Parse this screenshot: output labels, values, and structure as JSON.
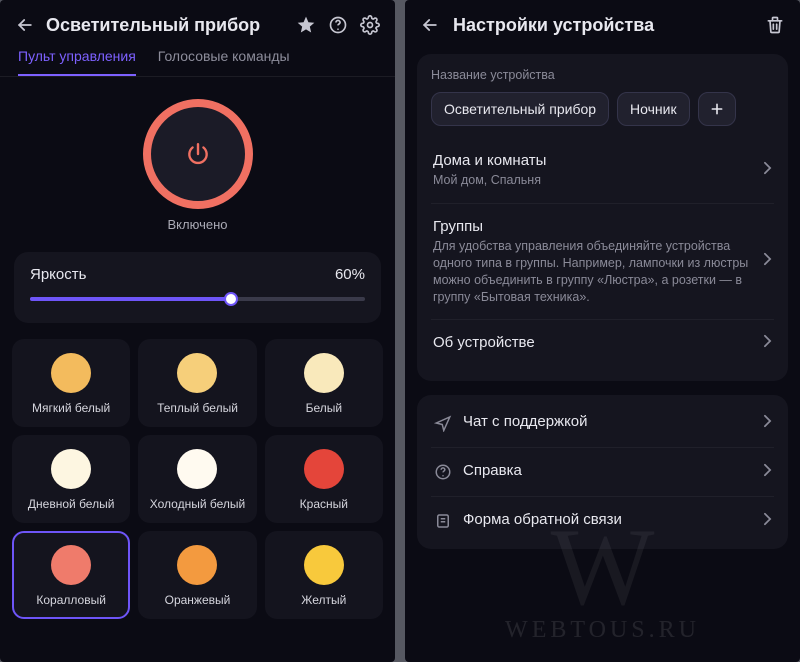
{
  "left": {
    "title": "Осветительный прибор",
    "tabs": {
      "control": "Пульт управления",
      "voice": "Голосовые команды"
    },
    "power_state": "Включено",
    "brightness": {
      "label": "Яркость",
      "value_text": "60%",
      "percent": 60
    },
    "colors": [
      {
        "name": "Мягкий белый",
        "hex": "#f3bb5d",
        "selected": false
      },
      {
        "name": "Теплый белый",
        "hex": "#f6cf7a",
        "selected": false
      },
      {
        "name": "Белый",
        "hex": "#f9e9bb",
        "selected": false
      },
      {
        "name": "Дневной белый",
        "hex": "#fdf6e1",
        "selected": false
      },
      {
        "name": "Холодный белый",
        "hex": "#fffaf0",
        "selected": false
      },
      {
        "name": "Красный",
        "hex": "#e4453a",
        "selected": false
      },
      {
        "name": "Коралловый",
        "hex": "#ef7b6b",
        "selected": true
      },
      {
        "name": "Оранжевый",
        "hex": "#f39a3f",
        "selected": false
      },
      {
        "name": "Желтый",
        "hex": "#f8c93c",
        "selected": false
      }
    ]
  },
  "right": {
    "title": "Настройки устройства",
    "device_name_section": {
      "label": "Название устройства",
      "chips": [
        "Осветительный прибор",
        "Ночник"
      ]
    },
    "rows1": [
      {
        "title": "Дома и комнаты",
        "sub": "Мой дом, Спальня"
      },
      {
        "title": "Группы",
        "sub": "Для удобства управления объединяйте устройства одного типа в группы. Например, лампочки из люстры можно объединить в группу «Люстра», а розетки — в группу «Бытовая техника»."
      },
      {
        "title": "Об устройстве",
        "sub": ""
      }
    ],
    "rows2": [
      {
        "icon": "chat",
        "title": "Чат с поддержкой"
      },
      {
        "icon": "help",
        "title": "Справка"
      },
      {
        "icon": "form",
        "title": "Форма обратной связи"
      }
    ]
  },
  "watermark": "WEBTOUS.RU"
}
